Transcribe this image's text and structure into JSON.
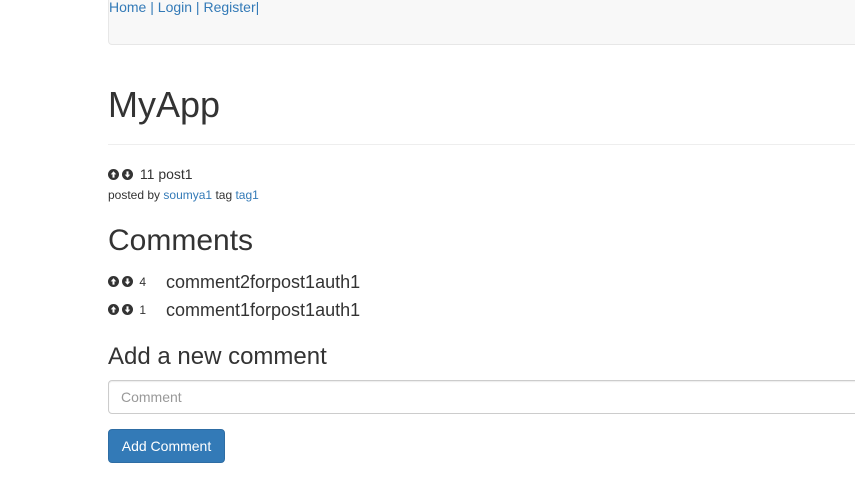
{
  "nav": {
    "home": "Home",
    "login": "Login",
    "register": "Register",
    "separator": " | ",
    "trailing": "|"
  },
  "app_title": "MyApp",
  "post": {
    "score": "11",
    "title": "post1",
    "posted_by_prefix": "posted by",
    "author": "soumya1",
    "tag_prefix": "tag",
    "tag": "tag1"
  },
  "comments": {
    "heading": "Comments",
    "items": [
      {
        "score": "4",
        "text": "comment2forpost1auth1"
      },
      {
        "score": "1",
        "text": "comment1forpost1auth1"
      }
    ]
  },
  "new_comment": {
    "heading": "Add a new comment",
    "placeholder": "Comment",
    "value": "",
    "button_label": "Add Comment"
  },
  "colors": {
    "link": "#337ab7",
    "primary_button": "#337ab7",
    "navbar_bg": "#f8f8f8"
  },
  "icons": {
    "upvote": "circle-arrow-up-icon",
    "downvote": "circle-arrow-down-icon"
  }
}
